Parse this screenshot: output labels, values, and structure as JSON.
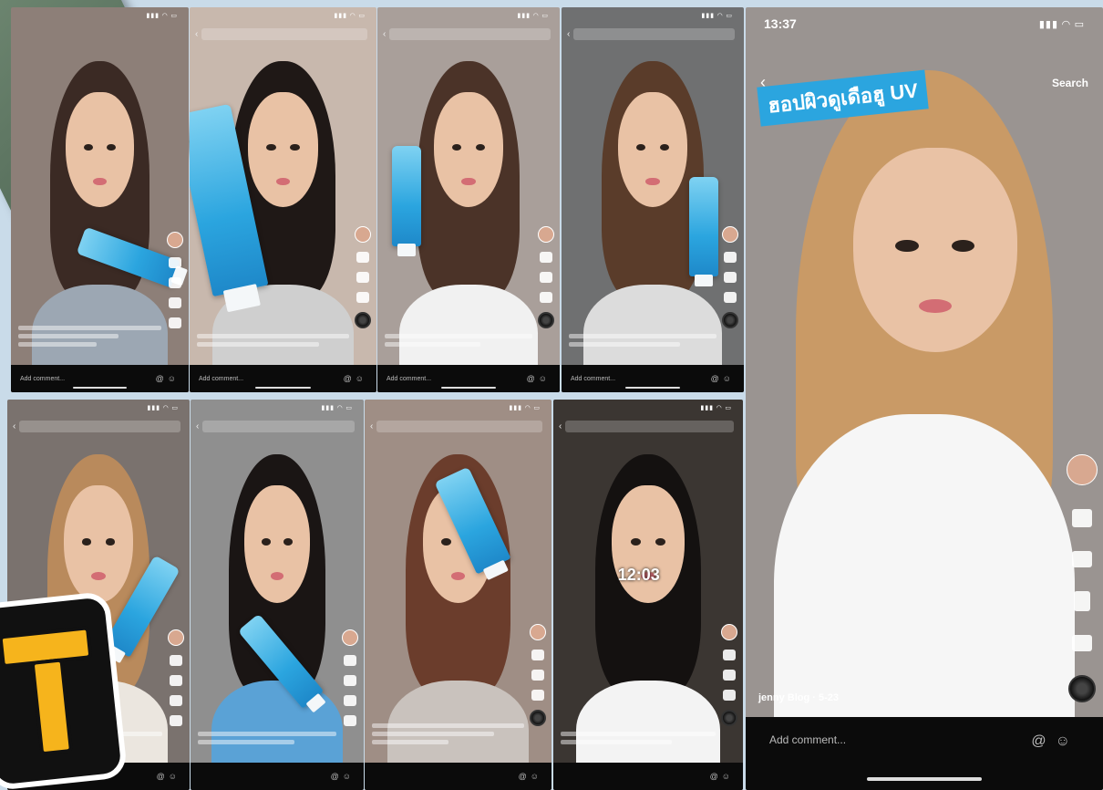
{
  "collage": {
    "background": "#c9dbe9",
    "accent_blue": "#2ba5df"
  },
  "phones": [
    {
      "time": "",
      "search_placeholder": "",
      "search_btn": "",
      "user": "",
      "comment_placeholder": "Add comment...",
      "bg": "#8d7f78",
      "hair": "#3b2a24",
      "shirt": "#9ca7b3",
      "has_tube": true
    },
    {
      "time": "",
      "search_placeholder": "",
      "search_btn": "",
      "user": "",
      "comment_placeholder": "Add comment...",
      "bg": "#c8b8ad",
      "hair": "#1f1816",
      "shirt": "#cfcfcf",
      "has_tube": true
    },
    {
      "time": "",
      "search_placeholder": "",
      "search_btn": "",
      "user": "",
      "comment_placeholder": "Add comment...",
      "bg": "#a99f9a",
      "hair": "#4b3328",
      "shirt": "#f1f1f1",
      "has_tube": true
    },
    {
      "time": "",
      "search_placeholder": "",
      "search_btn": "",
      "user": "",
      "comment_placeholder": "Add comment...",
      "bg": "#6f7071",
      "hair": "#5a3c2a",
      "shirt": "#dcdcdc",
      "has_tube": true,
      "overlay": ""
    },
    {
      "time": "",
      "search_placeholder": "",
      "search_btn": "",
      "user": "",
      "comment_placeholder": "",
      "bg": "#7a726e",
      "hair": "#b98a5c",
      "shirt": "#ebe6df",
      "has_tube": true
    },
    {
      "time": "",
      "search_placeholder": "",
      "search_btn": "",
      "user": "",
      "comment_placeholder": "",
      "bg": "#8f8f8f",
      "hair": "#1a1514",
      "shirt": "#5aa2d6",
      "has_tube": true
    },
    {
      "time": "",
      "search_placeholder": "",
      "search_btn": "",
      "user": "",
      "comment_placeholder": "",
      "bg": "#9f8e85",
      "hair": "#6b3d2c",
      "shirt": "#c9c2bd",
      "has_tube": true
    },
    {
      "time": "",
      "search_placeholder": "",
      "search_btn": "",
      "user": "",
      "comment_placeholder": "",
      "bg": "#3b3632",
      "hair": "#141110",
      "shirt": "#f3f3f3",
      "has_tube": false,
      "overlay": "12:03"
    }
  ],
  "featured": {
    "time": "13:37",
    "search_btn": "Search",
    "overlay_line1": "ฮอปผิวดูเดือฮู UV",
    "overlay_line2": "",
    "user": "jenny Blog · 5-23",
    "desc": "",
    "see": "",
    "comment_placeholder": "Add comment...",
    "bg": "#9a9491",
    "hair": "#c99a66",
    "shirt": "#f6f6f6"
  },
  "logo": {
    "letter": "T",
    "color": "#f6b41c"
  }
}
